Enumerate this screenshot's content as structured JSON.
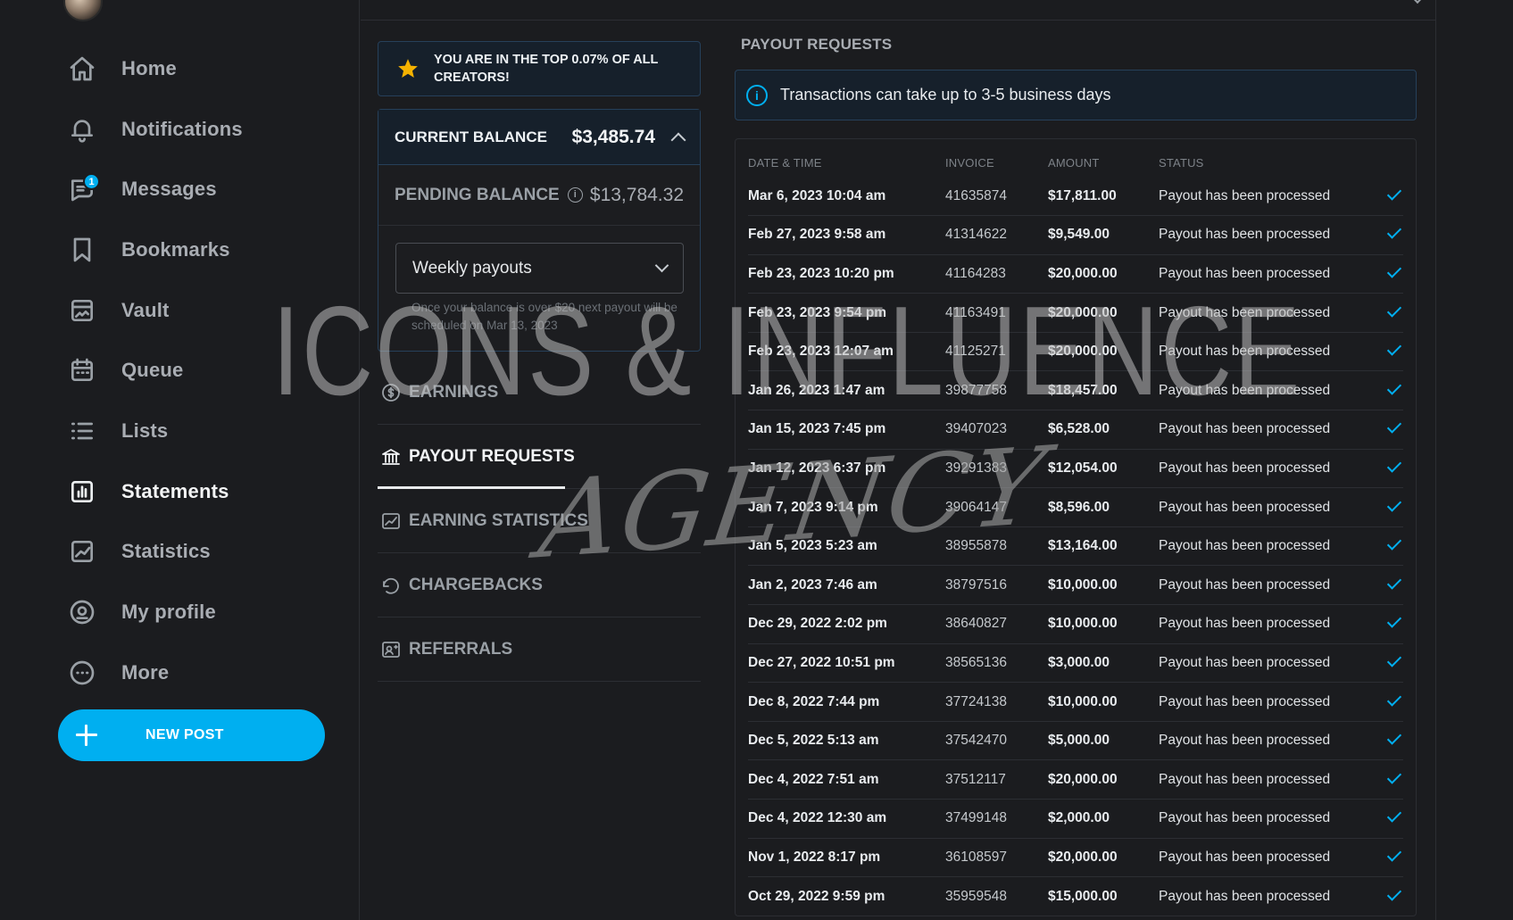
{
  "sidebar": {
    "items": [
      {
        "label": "Home",
        "icon": "home-icon"
      },
      {
        "label": "Notifications",
        "icon": "bell-icon"
      },
      {
        "label": "Messages",
        "icon": "message-icon",
        "badge": "1"
      },
      {
        "label": "Bookmarks",
        "icon": "bookmark-icon"
      },
      {
        "label": "Vault",
        "icon": "vault-icon"
      },
      {
        "label": "Queue",
        "icon": "calendar-icon"
      },
      {
        "label": "Lists",
        "icon": "list-icon"
      },
      {
        "label": "Statements",
        "icon": "statements-icon",
        "active": true
      },
      {
        "label": "Statistics",
        "icon": "chart-icon"
      },
      {
        "label": "My profile",
        "icon": "profile-icon"
      },
      {
        "label": "More",
        "icon": "more-icon"
      }
    ],
    "new_post": "NEW POST"
  },
  "banner": {
    "text": "YOU ARE IN THE TOP 0.07% OF ALL CREATORS!"
  },
  "balance": {
    "current_label": "CURRENT BALANCE",
    "current_value": "$3,485.74",
    "pending_label": "PENDING BALANCE",
    "pending_value": "$13,784.32",
    "payout_select": "Weekly payouts",
    "note": "Once your balance is over $20 next payout will be scheduled on Mar 13, 2023"
  },
  "menu": [
    {
      "label": "EARNINGS",
      "icon": "dollar-circle-icon"
    },
    {
      "label": "PAYOUT REQUESTS",
      "icon": "bank-icon",
      "active": true
    },
    {
      "label": "EARNING STATISTICS",
      "icon": "trend-icon"
    },
    {
      "label": "CHARGEBACKS",
      "icon": "undo-icon"
    },
    {
      "label": "REFERRALS",
      "icon": "referral-icon"
    }
  ],
  "payouts": {
    "title": "PAYOUT REQUESTS",
    "info": "Transactions can take up to 3-5 business days",
    "columns": [
      "DATE & TIME",
      "INVOICE",
      "AMOUNT",
      "STATUS"
    ],
    "rows": [
      {
        "date": "Mar 6, 2023 10:04 am",
        "invoice": "41635874",
        "amount": "$17,811.00",
        "status": "Payout has been processed"
      },
      {
        "date": "Feb 27, 2023 9:58 am",
        "invoice": "41314622",
        "amount": "$9,549.00",
        "status": "Payout has been processed"
      },
      {
        "date": "Feb 23, 2023 10:20 pm",
        "invoice": "41164283",
        "amount": "$20,000.00",
        "status": "Payout has been processed"
      },
      {
        "date": "Feb 23, 2023 9:54 pm",
        "invoice": "41163491",
        "amount": "$20,000.00",
        "status": "Payout has been processed"
      },
      {
        "date": "Feb 23, 2023 12:07 am",
        "invoice": "41125271",
        "amount": "$20,000.00",
        "status": "Payout has been processed"
      },
      {
        "date": "Jan 26, 2023 1:47 am",
        "invoice": "39877758",
        "amount": "$18,457.00",
        "status": "Payout has been processed"
      },
      {
        "date": "Jan 15, 2023 7:45 pm",
        "invoice": "39407023",
        "amount": "$6,528.00",
        "status": "Payout has been processed"
      },
      {
        "date": "Jan 12, 2023 6:37 pm",
        "invoice": "39291383",
        "amount": "$12,054.00",
        "status": "Payout has been processed"
      },
      {
        "date": "Jan 7, 2023 9:14 pm",
        "invoice": "39064147",
        "amount": "$8,596.00",
        "status": "Payout has been processed"
      },
      {
        "date": "Jan 5, 2023 5:23 am",
        "invoice": "38955878",
        "amount": "$13,164.00",
        "status": "Payout has been processed"
      },
      {
        "date": "Jan 2, 2023 7:46 am",
        "invoice": "38797516",
        "amount": "$10,000.00",
        "status": "Payout has been processed"
      },
      {
        "date": "Dec 29, 2022 2:02 pm",
        "invoice": "38640827",
        "amount": "$10,000.00",
        "status": "Payout has been processed"
      },
      {
        "date": "Dec 27, 2022 10:51 pm",
        "invoice": "38565136",
        "amount": "$3,000.00",
        "status": "Payout has been processed"
      },
      {
        "date": "Dec 8, 2022 7:44 pm",
        "invoice": "37724138",
        "amount": "$10,000.00",
        "status": "Payout has been processed"
      },
      {
        "date": "Dec 5, 2022 5:13 am",
        "invoice": "37542470",
        "amount": "$5,000.00",
        "status": "Payout has been processed"
      },
      {
        "date": "Dec 4, 2022 7:51 am",
        "invoice": "37512117",
        "amount": "$20,000.00",
        "status": "Payout has been processed"
      },
      {
        "date": "Dec 4, 2022 12:30 am",
        "invoice": "37499148",
        "amount": "$2,000.00",
        "status": "Payout has been processed"
      },
      {
        "date": "Nov 1, 2022 8:17 pm",
        "invoice": "36108597",
        "amount": "$20,000.00",
        "status": "Payout has been processed"
      },
      {
        "date": "Oct 29, 2022 9:59 pm",
        "invoice": "35959548",
        "amount": "$15,000.00",
        "status": "Payout has been processed"
      }
    ]
  },
  "watermark": {
    "line1": "ICONS & INFLUENCE",
    "line2": "AGENCY"
  },
  "colors": {
    "accent": "#00aff0",
    "background": "#1b1c1f",
    "banner_bg": "#16202b",
    "star": "#f5b200"
  }
}
